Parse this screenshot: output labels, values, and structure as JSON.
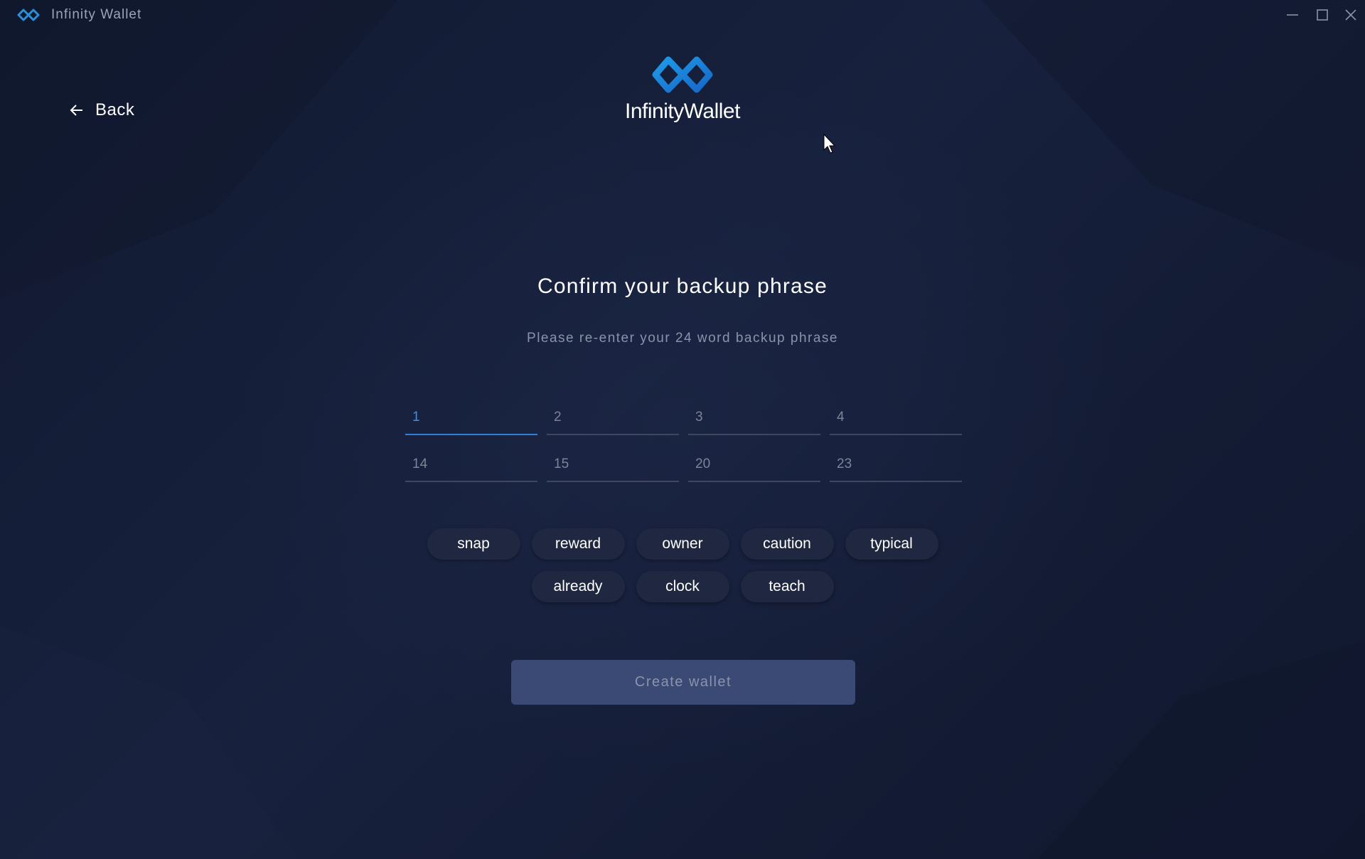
{
  "window": {
    "title": "Infinity Wallet"
  },
  "nav": {
    "back_label": "Back"
  },
  "brand": {
    "name": "InfinityWallet"
  },
  "main": {
    "heading": "Confirm your backup phrase",
    "subheading": "Please re-enter your 24 word backup phrase",
    "word_fields": [
      {
        "number": "1",
        "value": "",
        "active": true
      },
      {
        "number": "2",
        "value": "",
        "active": false
      },
      {
        "number": "3",
        "value": "",
        "active": false
      },
      {
        "number": "4",
        "value": "",
        "active": false
      },
      {
        "number": "14",
        "value": "",
        "active": false
      },
      {
        "number": "15",
        "value": "",
        "active": false
      },
      {
        "number": "20",
        "value": "",
        "active": false
      },
      {
        "number": "23",
        "value": "",
        "active": false
      }
    ],
    "word_options": [
      [
        "snap",
        "reward",
        "owner",
        "caution",
        "typical"
      ],
      [
        "already",
        "clock",
        "teach"
      ]
    ],
    "create_button_label": "Create wallet",
    "create_button_enabled": false
  },
  "icons": {
    "app_logo": "infinity-icon",
    "back": "arrow-left-icon",
    "minimize": "minimize-icon",
    "maximize": "maximize-icon",
    "close": "close-icon",
    "cursor": "mouse-pointer-icon"
  },
  "colors": {
    "background": "#131b33",
    "accent": "#2e7fd8",
    "chip": "#1f2840",
    "button_disabled": "#3a4a74"
  }
}
